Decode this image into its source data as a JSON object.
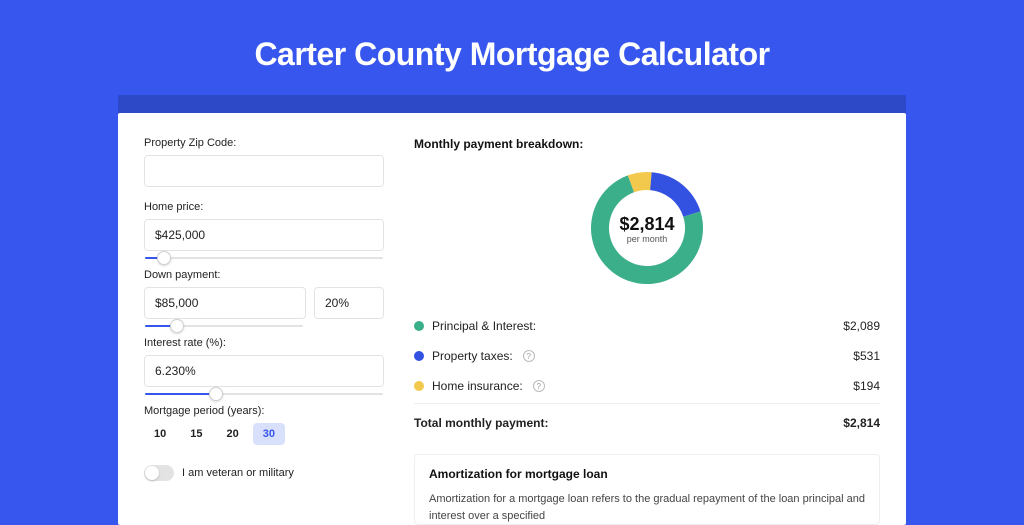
{
  "title": "Carter County Mortgage Calculator",
  "form": {
    "zip": {
      "label": "Property Zip Code:",
      "value": ""
    },
    "home_price": {
      "label": "Home price:",
      "value": "$425,000",
      "slider_pct": 8
    },
    "down_payment": {
      "label": "Down payment:",
      "value": "$85,000",
      "pct_value": "20%",
      "slider_pct": 20
    },
    "interest_rate": {
      "label": "Interest rate (%):",
      "value": "6.230%",
      "slider_pct": 30
    },
    "period": {
      "label": "Mortgage period (years):",
      "options": [
        "10",
        "15",
        "20",
        "30"
      ],
      "selected": "30"
    },
    "veteran": {
      "label": "I am veteran or military",
      "checked": false
    }
  },
  "breakdown": {
    "title": "Monthly payment breakdown:",
    "center_amount": "$2,814",
    "center_sub": "per month",
    "items": [
      {
        "label": "Principal & Interest:",
        "value": "$2,089",
        "color": "#3bae8a",
        "help": false
      },
      {
        "label": "Property taxes:",
        "value": "$531",
        "color": "#3452e1",
        "help": true
      },
      {
        "label": "Home insurance:",
        "value": "$194",
        "color": "#f2c94c",
        "help": true
      }
    ],
    "total_label": "Total monthly payment:",
    "total_value": "$2,814"
  },
  "amortization": {
    "title": "Amortization for mortgage loan",
    "text": "Amortization for a mortgage loan refers to the gradual repayment of the loan principal and interest over a specified"
  },
  "chart_data": {
    "type": "pie",
    "title": "Monthly payment breakdown",
    "series": [
      {
        "name": "Principal & Interest",
        "value": 2089,
        "color": "#3bae8a"
      },
      {
        "name": "Property taxes",
        "value": 531,
        "color": "#3452e1"
      },
      {
        "name": "Home insurance",
        "value": 194,
        "color": "#f2c94c"
      }
    ],
    "total": 2814,
    "unit": "USD per month"
  }
}
